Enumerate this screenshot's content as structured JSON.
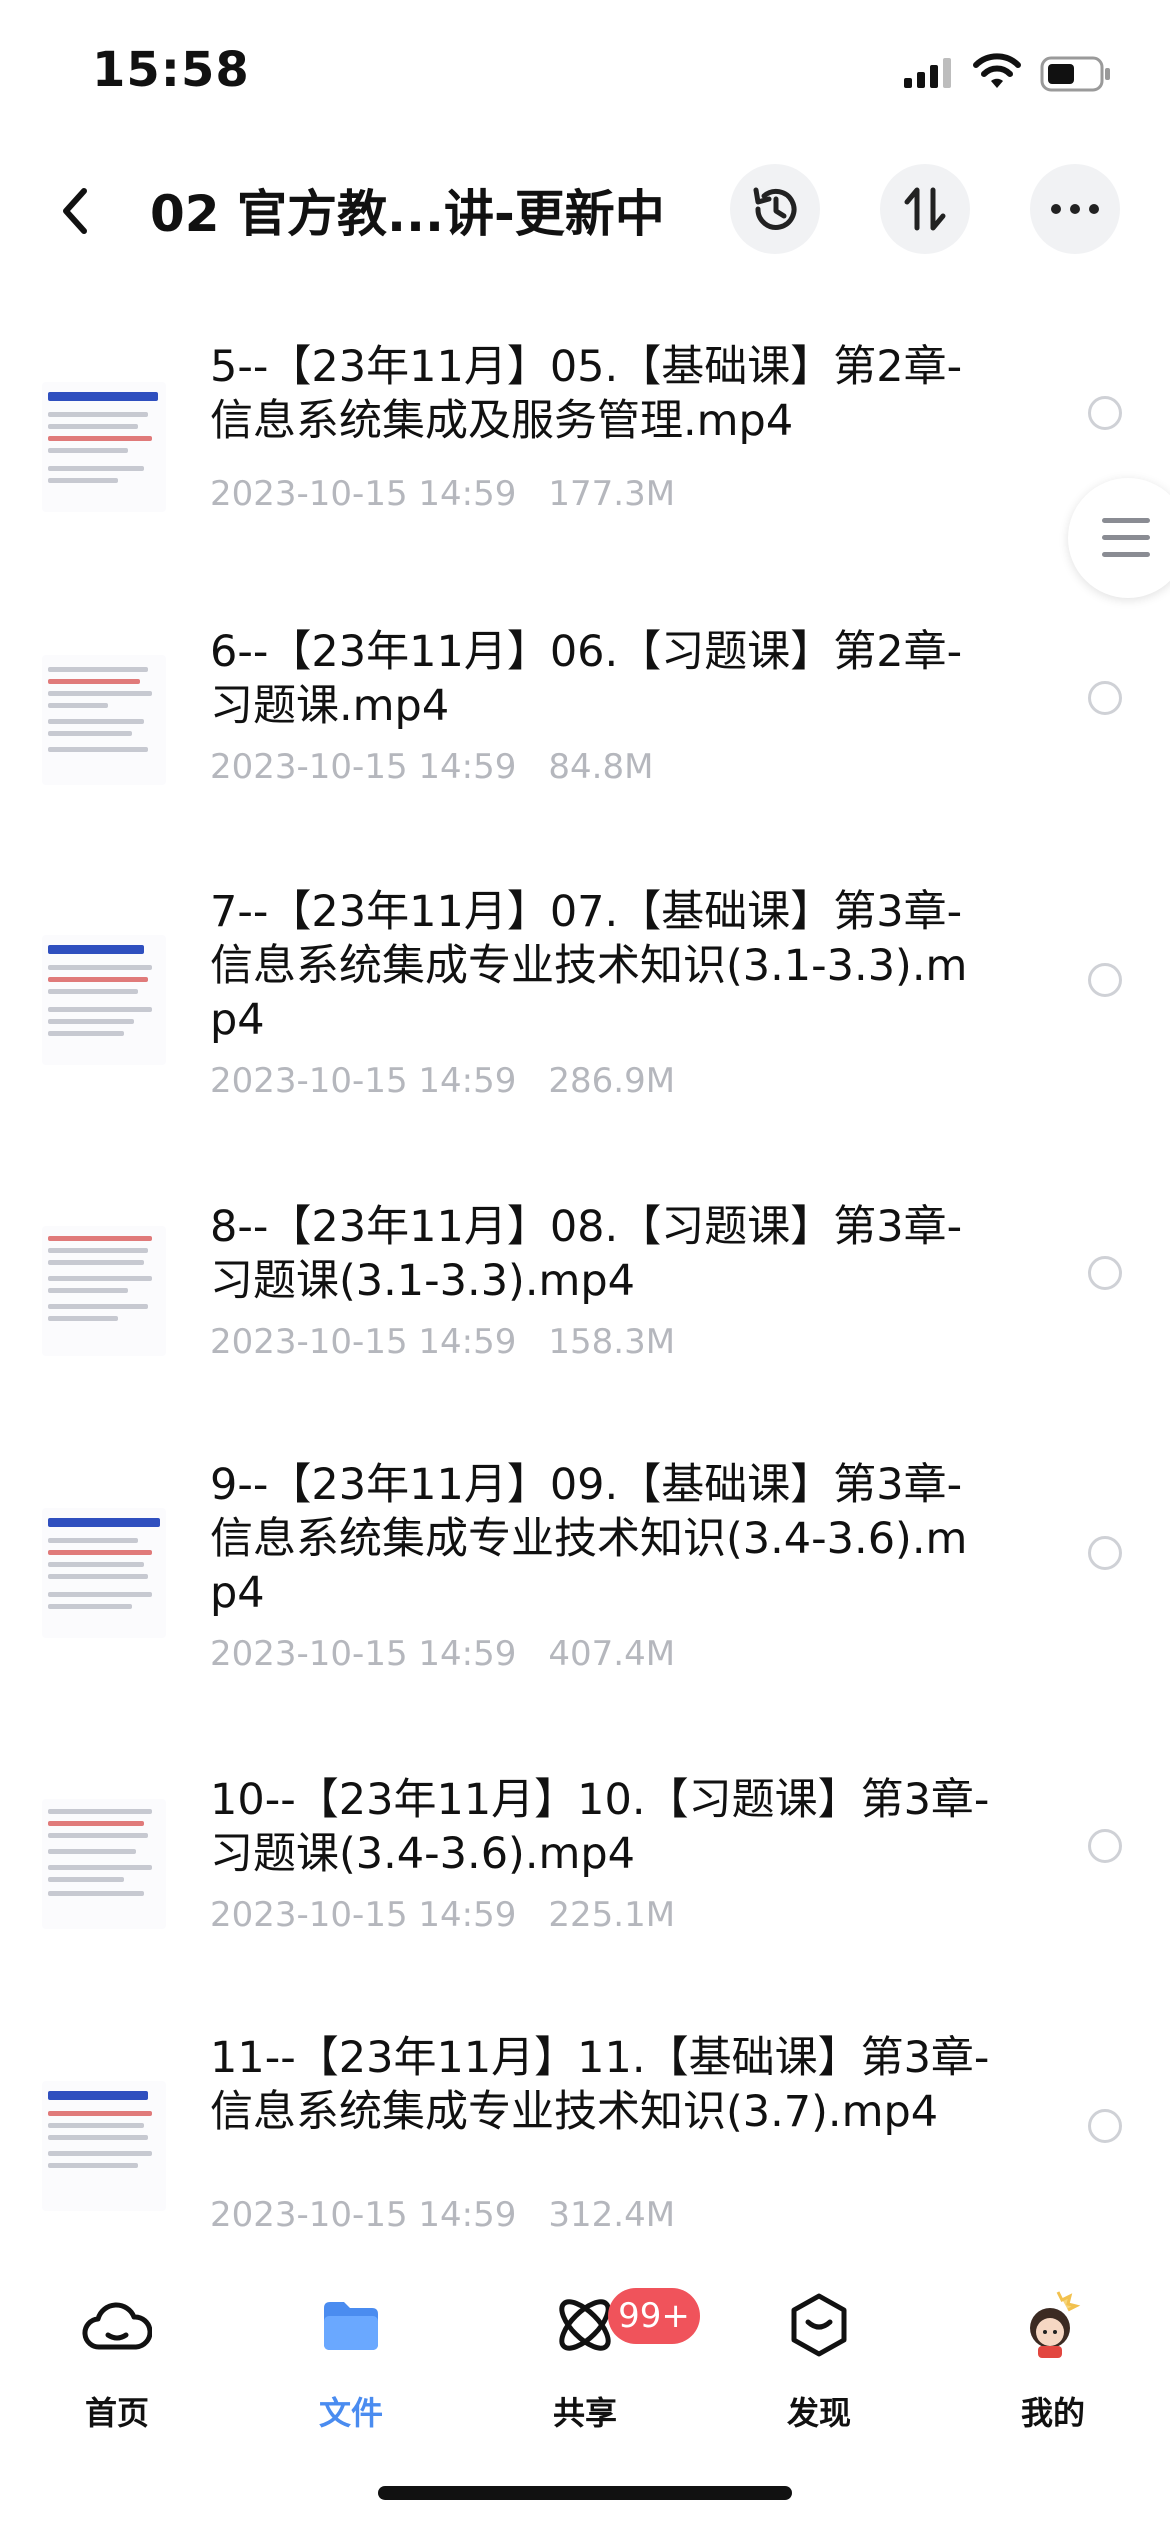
{
  "status_bar": {
    "time": "15:58"
  },
  "nav": {
    "title": "02 官方教...讲-更新中"
  },
  "files": [
    {
      "name": "5--【23年11月】05.【基础课】第2章-信息系统集成及服务管理.mp4",
      "date": "2023-10-15 14:59",
      "size": "177.3M",
      "thumb_title": "IT服务管理的核心思想",
      "thumb_accent": "#2f4fbf"
    },
    {
      "name": "6--【23年11月】06.【习题课】第2章-习题课.mp4",
      "date": "2023-10-15 14:59",
      "size": "84.8M",
      "thumb_title": "",
      "thumb_accent": "#7a7d86"
    },
    {
      "name": "7--【23年11月】07.【基础课】第3章-信息系统集成专业技术知识(3.1-3.3).mp4",
      "date": "2023-10-15 14:59",
      "size": "286.9M",
      "thumb_title": "结构化方法(掌握)",
      "thumb_accent": "#2f4fbf"
    },
    {
      "name": "8--【23年11月】08.【习题课】第3章-习题课(3.1-3.3).mp4",
      "date": "2023-10-15 14:59",
      "size": "158.3M",
      "thumb_title": "",
      "thumb_accent": "#7a7d86"
    },
    {
      "name": "9--【23年11月】09.【基础课】第3章-信息系统集成专业技术知识(3.4-3.6).mp4",
      "date": "2023-10-15 14:59",
      "size": "407.4M",
      "thumb_title": "面向对象系统分析与设计",
      "thumb_accent": "#2f4fbf"
    },
    {
      "name": "10--【23年11月】10.【习题课】第3章-习题课(3.4-3.6).mp4",
      "date": "2023-10-15 14:59",
      "size": "225.1M",
      "thumb_title": "",
      "thumb_accent": "#7a7d86"
    },
    {
      "name": "11--【23年11月】11.【基础课】第3章-信息系统集成专业技术知识(3.7).mp4",
      "date": "2023-10-15 14:59",
      "size": "312.4M",
      "thumb_title": "网络协议和标准(掌握)",
      "thumb_accent": "#2f4fbf"
    }
  ],
  "tabs": [
    {
      "label": "首页",
      "icon": "cloud-icon",
      "active": false
    },
    {
      "label": "文件",
      "icon": "folder-icon",
      "active": true
    },
    {
      "label": "共享",
      "icon": "share-icon",
      "active": false
    },
    {
      "label": "发现",
      "icon": "discover-icon",
      "active": false
    },
    {
      "label": "我的",
      "icon": "avatar",
      "active": false
    }
  ],
  "share_badge": "99+",
  "colors": {
    "accent": "#4a8cf0",
    "badge": "#f0535b",
    "meta_text": "#b5b7bd"
  }
}
